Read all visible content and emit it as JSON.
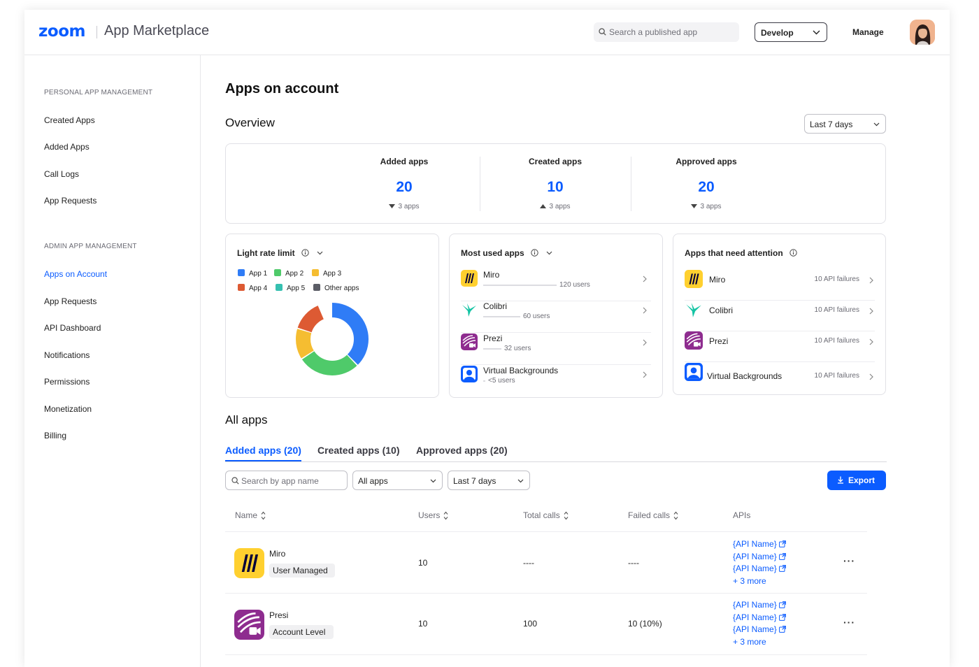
{
  "header": {
    "logo": "zoom",
    "product": "App Marketplace",
    "search_placeholder": "Search a published app",
    "develop_label": "Develop",
    "manage_label": "Manage"
  },
  "sidebar": {
    "personal_title": "PERSONAL APP MANAGEMENT",
    "personal_items": [
      "Created Apps",
      "Added Apps",
      "Call Logs",
      "App Requests"
    ],
    "admin_title": "ADMIN APP MANAGEMENT",
    "admin_items": [
      "Apps on Account",
      "App Requests",
      "API Dashboard",
      "Notifications",
      "Permissions",
      "Monetization",
      "Billing"
    ],
    "active_item": "Apps on Account"
  },
  "page": {
    "title": "Apps on account",
    "overview_title": "Overview",
    "range_label": "Last 7 days",
    "stats": [
      {
        "label": "Added apps",
        "value": "20",
        "delta": "3 apps",
        "direction": "down"
      },
      {
        "label": "Created apps",
        "value": "10",
        "delta": "3 apps",
        "direction": "up"
      },
      {
        "label": "Approved apps",
        "value": "20",
        "delta": "3 apps",
        "direction": "down"
      }
    ]
  },
  "rate_limit": {
    "title": "Light rate limit",
    "legend": [
      "App 1",
      "App 2",
      "App 3",
      "App 4",
      "App 5",
      "Other apps"
    ],
    "colors": [
      "#2f7cf6",
      "#4fca6a",
      "#f5bd31",
      "#dd5a33",
      "#36c0b0",
      "#5b5d66"
    ],
    "shares": [
      0.38,
      0.28,
      0.14,
      0.14,
      0.0,
      0.0
    ]
  },
  "most_used": {
    "title": "Most used apps",
    "items": [
      {
        "name": "Miro",
        "users": "120 users",
        "fill": 1.0
      },
      {
        "name": "Colibri",
        "users": "60 users",
        "fill": 0.5
      },
      {
        "name": "Prezi",
        "users": "32 users",
        "fill": 0.25
      },
      {
        "name": "Virtual Backgrounds",
        "users": "<5 users",
        "fill": 0.03
      }
    ]
  },
  "attention": {
    "title": "Apps that need attention",
    "items": [
      {
        "name": "Miro",
        "failures": "10 API failures"
      },
      {
        "name": "Colibri",
        "failures": "10 API failures"
      },
      {
        "name": "Prezi",
        "failures": "10 API failures"
      },
      {
        "name": "Virtual Backgrounds",
        "failures": "10 API failures"
      }
    ]
  },
  "all_apps": {
    "title": "All apps",
    "tabs": [
      "Added apps (20)",
      "Created apps (10)",
      "Approved apps (20)"
    ],
    "active_tab": 0,
    "search_placeholder": "Search by app name",
    "filter_label": "All apps",
    "range_label": "Last 7 days",
    "export_label": "Export",
    "columns": [
      "Name",
      "Users",
      "Total calls",
      "Failed calls",
      "APIs"
    ],
    "rows": [
      {
        "name": "Miro",
        "level": "User Managed",
        "users": "10",
        "total_calls": "----",
        "failed_calls": "----",
        "apis": [
          "{API Name}",
          "{API Name}",
          "{API Name}"
        ],
        "more": "+ 3 more"
      },
      {
        "name": "Presi",
        "level": "Account Level",
        "users": "10",
        "total_calls": "100",
        "failed_calls": "10 (10%)",
        "apis": [
          "{API Name}",
          "{API Name}",
          "{API Name}"
        ],
        "more": "+ 3 more"
      }
    ]
  }
}
